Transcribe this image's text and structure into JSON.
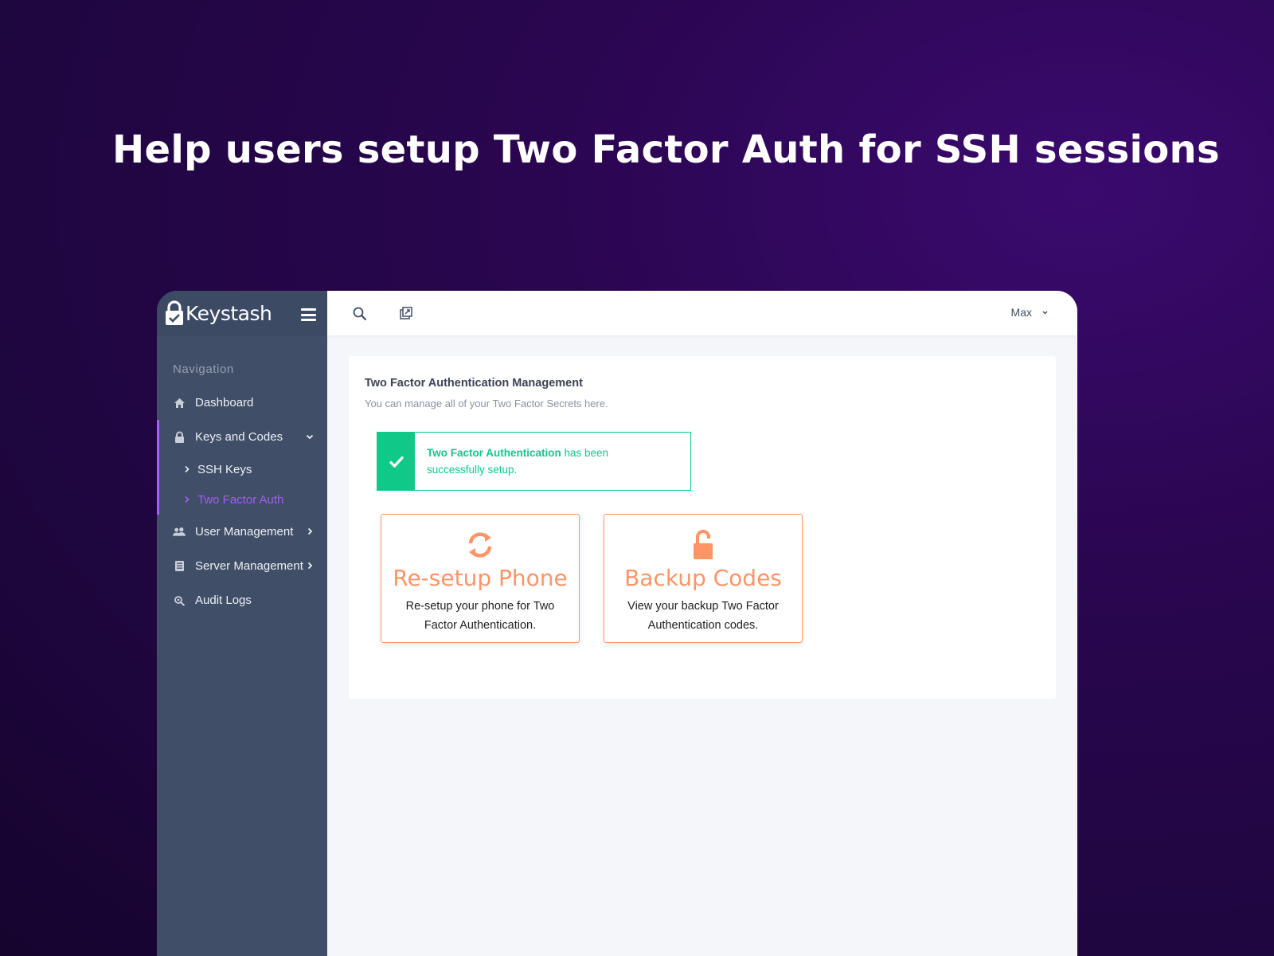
{
  "headline": "Help users setup Two Factor Auth for SSH sessions",
  "brand": {
    "name": "Keystash",
    "accent": "#a45ff3"
  },
  "sidebar": {
    "heading": "Navigation",
    "items": [
      {
        "label": "Dashboard",
        "icon": "home-icon"
      },
      {
        "label": "Keys and Codes",
        "icon": "lock-icon",
        "expanded": true,
        "children": [
          {
            "label": "SSH Keys",
            "active": false
          },
          {
            "label": "Two Factor Auth",
            "active": true
          }
        ]
      },
      {
        "label": "User Management",
        "icon": "users-icon"
      },
      {
        "label": "Server Management",
        "icon": "server-icon"
      },
      {
        "label": "Audit Logs",
        "icon": "audit-search-icon"
      }
    ]
  },
  "topbar": {
    "user": "Max"
  },
  "main": {
    "title": "Two Factor Authentication Management",
    "subtitle": "You can manage all of your Two Factor Secrets here.",
    "alert": {
      "bold": "Two Factor Authentication",
      "rest": " has been successfully setup.",
      "color": "#10c888"
    },
    "tiles": [
      {
        "title": "Re-setup Phone",
        "description": "Re-setup your phone for Two Factor Authentication.",
        "icon": "refresh-icon"
      },
      {
        "title": "Backup Codes",
        "description": "View your backup Two Factor Authentication codes.",
        "icon": "unlock-icon"
      }
    ],
    "tile_color": "#ff9466"
  }
}
